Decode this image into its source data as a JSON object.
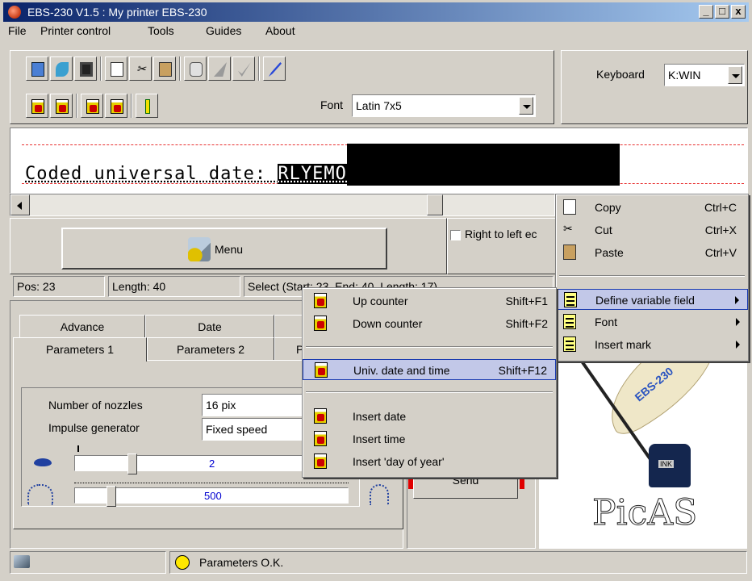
{
  "window": {
    "title": "EBS-230 V1.5  :  My printer EBS-230",
    "minimize": "_",
    "maximize": "□",
    "close": "x"
  },
  "menubar": [
    "File",
    "Printer control",
    "Tools",
    "Guides",
    "About"
  ],
  "keyboard": {
    "label": "Keyboard",
    "value": "K:WIN"
  },
  "font": {
    "label": "Font",
    "value": "Latin 7x5"
  },
  "editor": {
    "text_before": "Coded universal date: ",
    "text_selected": "RLYEMODA/BCIJTU/N"
  },
  "menu_button": {
    "label": "Menu"
  },
  "rtl_checkbox": {
    "label": "Right to left ec",
    "checked": false
  },
  "status": {
    "pos": "Pos: 23",
    "length": "Length: 40",
    "select": "Select (Start: 23, End: 40, Length: 17)"
  },
  "tabs": {
    "row_back": [
      "Advance",
      "Date"
    ],
    "row_front": [
      "Parameters 1",
      "Parameters 2",
      "P"
    ]
  },
  "parameters": {
    "nozzles_label": "Number of nozzles",
    "nozzles_value": "16 pix",
    "impulse_label": "Impulse generator",
    "impulse_value": "Fixed speed",
    "slider1_value": "2",
    "slider2_value": "500"
  },
  "send_button": "Send",
  "bottom_status": "Parameters O.K.",
  "context_menu": {
    "copy": {
      "label": "Copy",
      "shortcut": "Ctrl+C"
    },
    "cut": {
      "label": "Cut",
      "shortcut": "Ctrl+X"
    },
    "paste": {
      "label": "Paste",
      "shortcut": "Ctrl+V"
    },
    "define": "Define variable field",
    "font": "Font",
    "insert_mark": "Insert mark"
  },
  "submenu": {
    "up": {
      "label": "Up counter",
      "shortcut": "Shift+F1"
    },
    "down": {
      "label": "Down counter",
      "shortcut": "Shift+F2"
    },
    "univ": {
      "label": "Univ. date and time",
      "shortcut": "Shift+F12"
    },
    "insert_date": "Insert date",
    "insert_time": "Insert time",
    "insert_doy": "Insert 'day of year'"
  },
  "logo": {
    "brand": "EBS-230",
    "ink": "INK",
    "name": "PicAS"
  },
  "colors": {
    "titlebar": "#0a246a",
    "highlight": "#c2c8e8",
    "accent_blue": "#1a3bb0"
  }
}
